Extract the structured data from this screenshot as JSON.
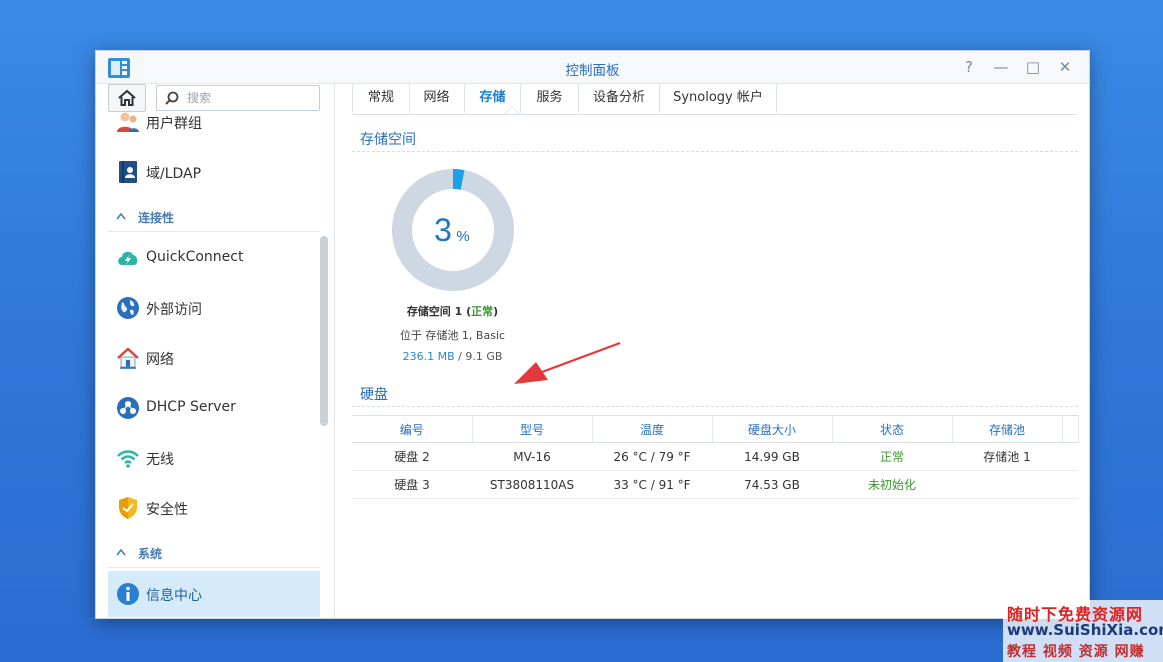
{
  "window": {
    "title": "控制面板"
  },
  "window_controls": {
    "help": "?",
    "minimize": "—",
    "maximize": "□",
    "close": "✕"
  },
  "sidebar": {
    "search_placeholder": "搜索",
    "items": [
      {
        "label": "用户群组",
        "icon": "user-group-icon"
      },
      {
        "label": "域/LDAP",
        "icon": "ldap-icon"
      },
      {
        "section": "连接性"
      },
      {
        "label": "QuickConnect",
        "icon": "quickconnect-icon"
      },
      {
        "label": "外部访问",
        "icon": "external-access-icon"
      },
      {
        "label": "网络",
        "icon": "network-house-icon"
      },
      {
        "label": "DHCP Server",
        "icon": "dhcp-icon"
      },
      {
        "label": "无线",
        "icon": "wireless-icon"
      },
      {
        "label": "安全性",
        "icon": "shield-icon"
      },
      {
        "section": "系统"
      },
      {
        "label": "信息中心",
        "icon": "info-icon",
        "active": true
      }
    ]
  },
  "tabs": [
    "常规",
    "网络",
    "存储",
    "服务",
    "设备分析",
    "Synology 帐户"
  ],
  "active_tab": "存储",
  "storage": {
    "section_title": "存储空间",
    "percent": "3",
    "percent_sign": "%",
    "usage_fraction": 0.03,
    "volume_name": "存储空间 1",
    "volume_status": "正常",
    "location": "位于 存储池 1, Basic",
    "used": "236.1 MB",
    "separator": " / ",
    "total": "9.1 GB"
  },
  "disks": {
    "section_title": "硬盘",
    "columns": [
      "编号",
      "型号",
      "温度",
      "硬盘大小",
      "状态",
      "存储池"
    ],
    "rows": [
      [
        "硬盘 2",
        "MV-16",
        "26 °C / 79 °F",
        "14.99 GB",
        "正常",
        "存储池 1"
      ],
      [
        "硬盘 3",
        "ST3808110AS",
        "33 °C / 91 °F",
        "74.53 GB",
        "未初始化",
        ""
      ]
    ]
  },
  "watermark": {
    "line1": "随时下免费资源网",
    "line2": "www.SuiShiXia.com",
    "line3": "教程 视频 资源 网赚"
  },
  "colors": {
    "accent": "#1a7fd4",
    "ok": "#3a9a2e",
    "donut_track": "#cdd8e2",
    "donut_fill": "#1ea0e8",
    "arrow": "#e23a3a"
  }
}
